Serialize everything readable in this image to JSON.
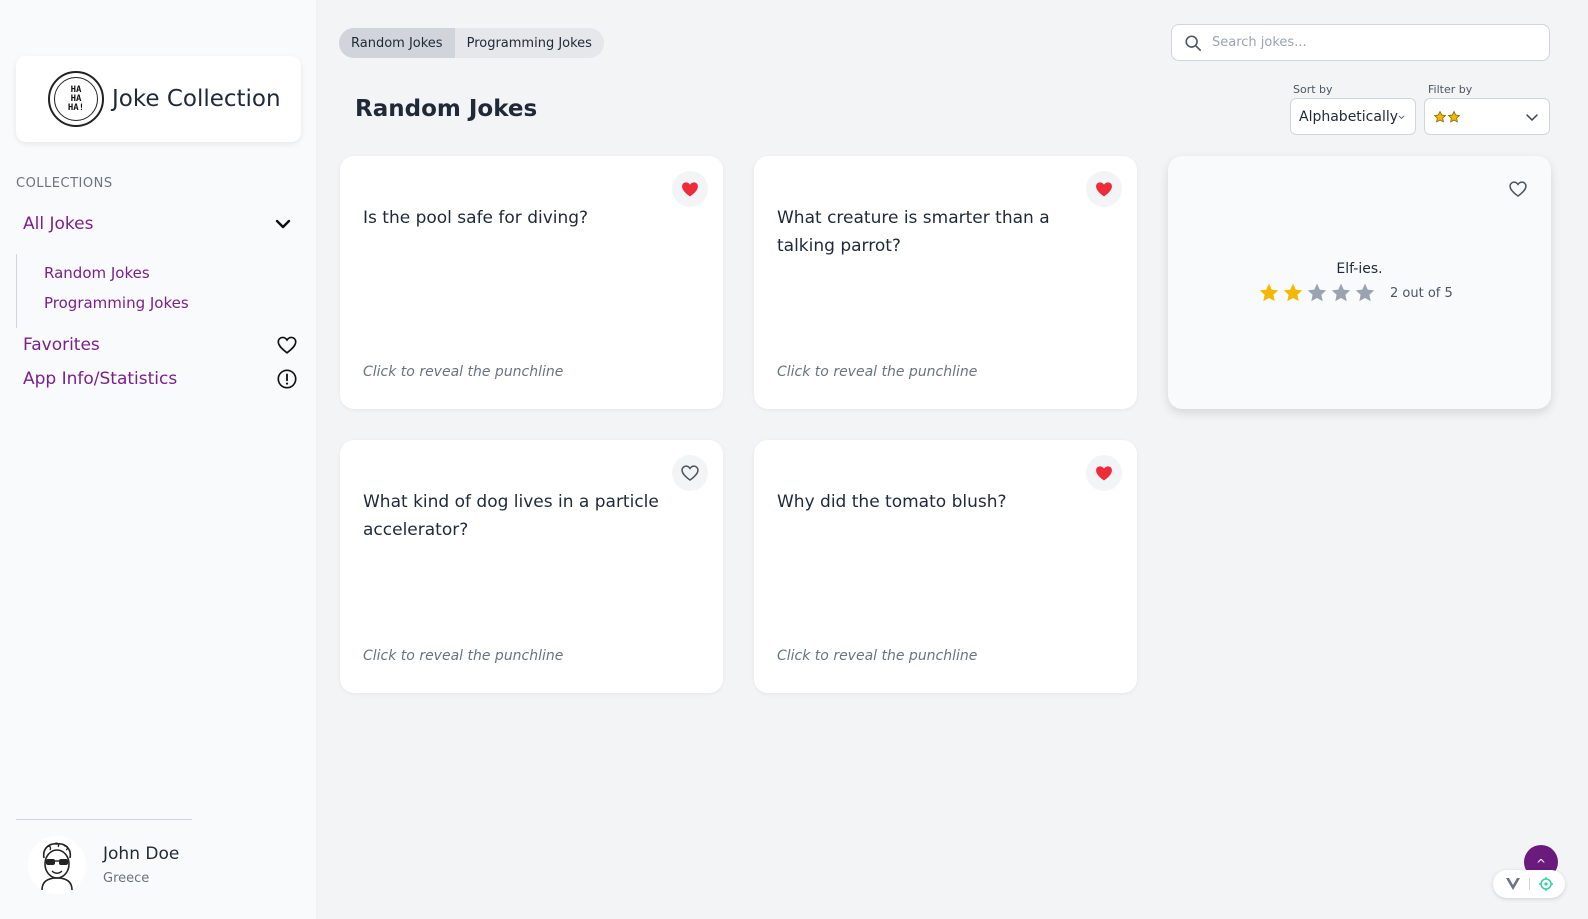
{
  "app": {
    "title": "Joke Collection",
    "logo_text": [
      "HA",
      "HA",
      "HA!"
    ]
  },
  "sidebar": {
    "section_label": "COLLECTIONS",
    "all_jokes": "All Jokes",
    "sub_items": [
      "Random Jokes",
      "Programming Jokes"
    ],
    "favorites": "Favorites",
    "app_info": "App Info/Statistics"
  },
  "user": {
    "name": "John Doe",
    "country": "Greece"
  },
  "tabs": [
    {
      "label": "Random Jokes",
      "active": true
    },
    {
      "label": "Programming Jokes",
      "active": false
    }
  ],
  "search": {
    "placeholder": "Search jokes...",
    "value": ""
  },
  "main": {
    "title": "Random Jokes"
  },
  "sort": {
    "label": "Sort by",
    "value": "Alphabetically"
  },
  "filter": {
    "label": "Filter by",
    "value_stars": 2
  },
  "cards": [
    {
      "setup": "Is the pool safe for diving?",
      "hint": "Click to reveal the punchline",
      "favorite": true,
      "revealed": false
    },
    {
      "setup": "What creature is smarter than a talking parrot?",
      "hint": "Click to reveal the punchline",
      "favorite": true,
      "revealed": false
    },
    {
      "punchline": "Elf-ies.",
      "rating": 2,
      "rating_max": 5,
      "rating_text": "2 out of 5",
      "favorite": false,
      "revealed": true
    },
    {
      "setup": "What kind of dog lives in a particle accelerator?",
      "hint": "Click to reveal the punchline",
      "favorite": false,
      "revealed": false
    },
    {
      "setup": "Why did the tomato blush?",
      "hint": "Click to reveal the punchline",
      "favorite": true,
      "revealed": false
    }
  ],
  "colors": {
    "accent": "#7b1f8c",
    "heart": "#ef2b3a",
    "star_filled": "#f5b800",
    "star_empty": "#9aa3af"
  }
}
